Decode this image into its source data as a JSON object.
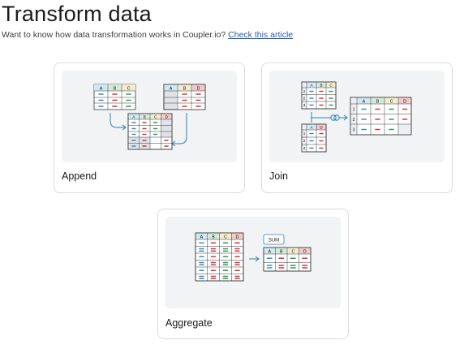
{
  "header": {
    "title": "Transform data",
    "subtitle_text": "Want to know how data transformation works in Coupler.io?",
    "article_link": "Check this article"
  },
  "cards": {
    "append": {
      "label": "Append"
    },
    "join": {
      "label": "Join"
    },
    "aggregate": {
      "label": "Aggregate",
      "sum_badge": "SUM"
    }
  },
  "table_headers": {
    "a": "A",
    "b": "B",
    "c": "C",
    "d": "D",
    "r1": "1",
    "r2": "2",
    "r3": "3",
    "r4": "4"
  },
  "colors": {
    "accent_blue": "#2f7fb4",
    "header_blue": "#cfe8f4",
    "header_green": "#d4ead8",
    "header_yellow": "#f3eccc",
    "header_red": "#f2c9c9",
    "dash_blue": "#3a8cc4",
    "dash_green": "#2f9a5a",
    "dash_red": "#cf3a3a",
    "card_border": "#dcdcdc",
    "preview_bg": "#f2f3f5",
    "link": "#2a5db0"
  }
}
